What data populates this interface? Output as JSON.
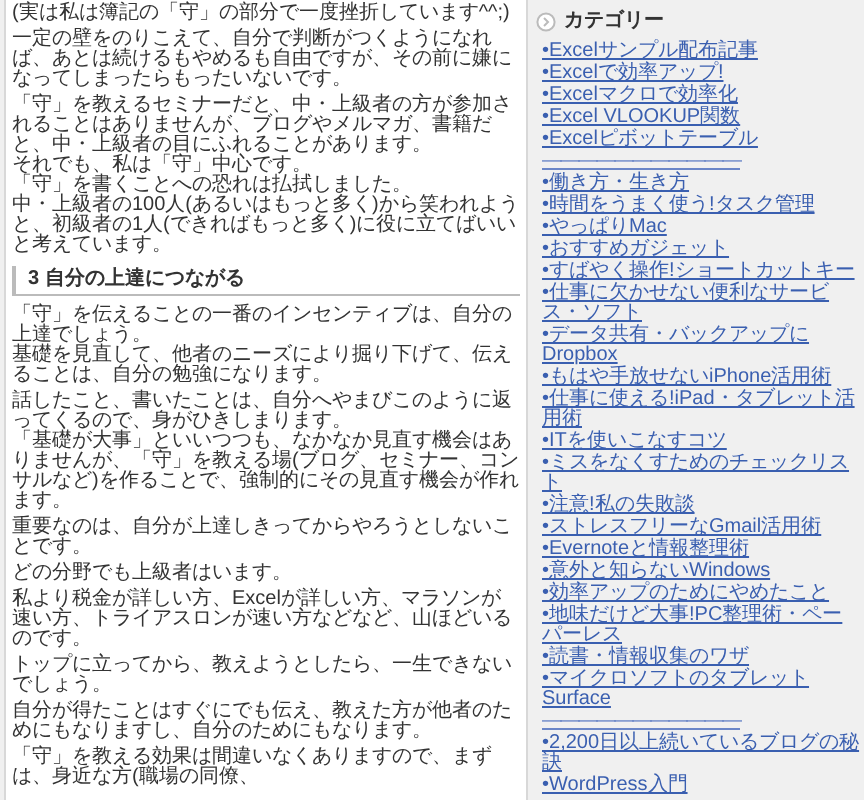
{
  "article": {
    "blocks": [
      {
        "kind": "paragraph",
        "lines": [
          "(実は私は簿記の「守」の部分で一度挫折しています^^;)"
        ]
      },
      {
        "kind": "paragraph",
        "lines": [
          "一定の壁をのりこえて、自分で判断がつくようになれば、あとは続けるもやめるも自由ですが、その前に嫌になってしまったらもったいないです。"
        ]
      },
      {
        "kind": "paragraph",
        "lines": [
          "「守」を教えるセミナーだと、中・上級者の方が参加されることはありませんが、ブログやメルマガ、書籍だと、中・上級者の目にふれることがあります。",
          "それでも、私は「守」中心です。",
          "「守」を書くことへの恐れは払拭しました。",
          "中・上級者の100人(あるいはもっと多く)から笑われようと、初級者の1人(できればもっと多く)に役に立てばいいと考えています。"
        ]
      },
      {
        "kind": "heading",
        "text": "3 自分の上達につながる"
      },
      {
        "kind": "paragraph",
        "lines": [
          "「守」を伝えることの一番のインセンティブは、自分の上達でしょう。",
          "基礎を見直して、他者のニーズにより掘り下げて、伝えることは、自分の勉強になります。"
        ]
      },
      {
        "kind": "paragraph",
        "lines": [
          "話したこと、書いたことは、自分へやまびこのように返ってくるので、身がひきしまります。",
          "「基礎が大事」といいつつも、なかなか見直す機会はありませんが、「守」を教える場(ブログ、セミナー、コンサルなど)を作ることで、強制的にその見直す機会が作れます。"
        ]
      },
      {
        "kind": "paragraph",
        "lines": [
          "重要なのは、自分が上達しきってからやろうとしないことです。"
        ]
      },
      {
        "kind": "paragraph",
        "lines": [
          "どの分野でも上級者はいます。"
        ]
      },
      {
        "kind": "paragraph",
        "lines": [
          "私より税金が詳しい方、Excelが詳しい方、マラソンが速い方、トライアスロンが速い方などなど、山ほどいるのです。"
        ]
      },
      {
        "kind": "paragraph",
        "lines": [
          "トップに立ってから、教えようとしたら、一生できないでしょう。"
        ]
      },
      {
        "kind": "paragraph",
        "lines": [
          "自分が得たことはすぐにでも伝え、教えた方が他者のためにもなりますし、自分のためにもなります。"
        ]
      },
      {
        "kind": "paragraph",
        "lines": [
          "「守」を教える効果は間違いなくありますので、まずは、身近な方(職場の同僚、"
        ]
      }
    ]
  },
  "sidebar": {
    "title": "カテゴリー",
    "items": [
      {
        "kind": "link",
        "text": "•Excelサンプル配布記事"
      },
      {
        "kind": "link",
        "text": "•Excelで効率アップ!"
      },
      {
        "kind": "link",
        "text": "•Excelマクロで効率化"
      },
      {
        "kind": "link",
        "text": "•Excel VLOOKUP関数"
      },
      {
        "kind": "link",
        "text": "•Excelピボットテーブル"
      },
      {
        "kind": "divider",
        "text": "―――――――――――"
      },
      {
        "kind": "link",
        "text": "•働き方・生き方"
      },
      {
        "kind": "link",
        "text": "•時間をうまく使う!タスク管理"
      },
      {
        "kind": "link",
        "text": "•やっぱりMac"
      },
      {
        "kind": "link",
        "text": "•おすすめガジェット"
      },
      {
        "kind": "link",
        "text": "•すばやく操作!ショートカットキー"
      },
      {
        "kind": "link",
        "text": "•仕事に欠かせない便利なサービス・ソフト"
      },
      {
        "kind": "link",
        "text": "•データ共有・バックアップにDropbox"
      },
      {
        "kind": "link",
        "text": "•もはや手放せないiPhone活用術"
      },
      {
        "kind": "link",
        "text": "•仕事に使える!iPad・タブレット活用術"
      },
      {
        "kind": "link",
        "text": "•ITを使いこなすコツ"
      },
      {
        "kind": "link",
        "text": "•ミスをなくすためのチェックリスト"
      },
      {
        "kind": "link",
        "text": "•注意!私の失敗談"
      },
      {
        "kind": "link",
        "text": "•ストレスフリーなGmail活用術"
      },
      {
        "kind": "link",
        "text": "•Evernoteと情報整理術"
      },
      {
        "kind": "link",
        "text": "•意外と知らないWindows"
      },
      {
        "kind": "link",
        "text": "•効率アップのためにやめたこと"
      },
      {
        "kind": "link",
        "text": "•地味だけど大事!PC整理術・ペーパーレス"
      },
      {
        "kind": "link",
        "text": "•読書・情報収集のワザ"
      },
      {
        "kind": "link",
        "text": "•マイクロソフトのタブレットSurface"
      },
      {
        "kind": "divider",
        "text": "―――――――――――"
      },
      {
        "kind": "link",
        "text": "•2,200日以上続いているブログの秘訣"
      },
      {
        "kind": "link",
        "text": "•WordPress入門"
      }
    ]
  }
}
